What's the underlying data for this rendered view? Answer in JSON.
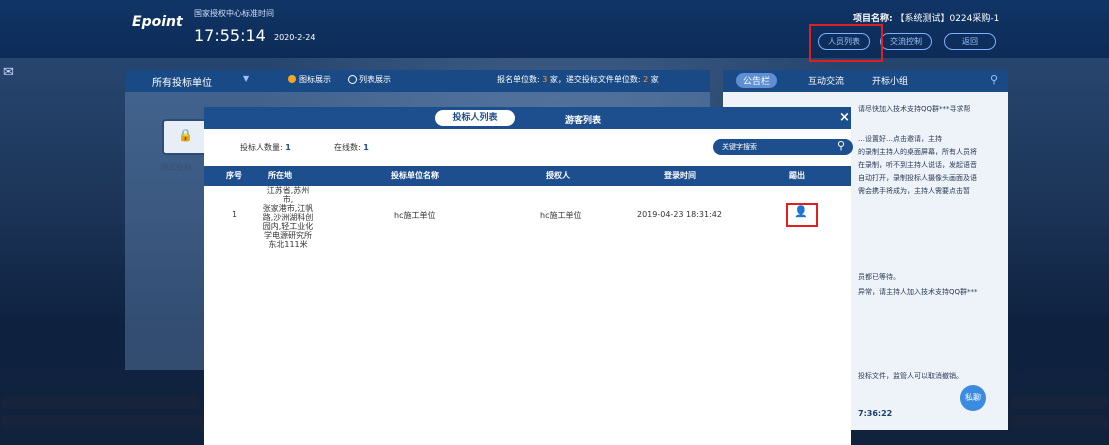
{
  "header": {
    "logo": "Epoint",
    "clock_label": "国家授权中心标准时间",
    "clock_time": "17:55:14",
    "clock_date": "2020-2-24",
    "project_label": "项目名称:",
    "project_value": "【系统测试】0224采购-1",
    "buttons": {
      "people": "人员列表",
      "flow": "交流控制",
      "back": "返回"
    }
  },
  "bidder_panel": {
    "unit_select": "所有投标单位",
    "view_icon_label": "图标展示",
    "view_list_label": "列表展示",
    "stats": {
      "prefix": "报名单位数:",
      "registered": "3",
      "mid": "家，递交投标文件单位数:",
      "submitted": "2",
      "suffix": "家"
    },
    "folder_label": "测试投标"
  },
  "side_panel": {
    "tabs": [
      "公告栏",
      "互动交流",
      "开标小组"
    ],
    "lines": [
      "请尽快加入技术支持QQ群***寻求帮",
      "…设置好…点击邀请，主持",
      "的录制主持人的桌面屏幕，所有人员将",
      "在录制，听不到主持人说话，发起语音",
      "自动打开，录制投标人摄像头画面及语",
      "需会携手将成为，主持人需要点击暂",
      "员都已等待。",
      "异常，请主持人加入技术支持QQ群***",
      "投标文件，监管人可以取消撤销。"
    ],
    "time": "7:36:22",
    "private_btn": "私聊"
  },
  "modal": {
    "tabs": {
      "bidders": "投标人列表",
      "guests": "游客列表"
    },
    "close": "×",
    "count_label": "投标人数量:",
    "count_value": "1",
    "online_label": "在线数:",
    "online_value": "1",
    "search_placeholder": "关键字搜索",
    "columns": [
      "序号",
      "所在地",
      "投标单位名称",
      "授权人",
      "登录时间",
      "踢出"
    ],
    "rows": [
      {
        "no": "1",
        "location_lines": [
          "江苏省,苏州市,",
          "张家港市,江帆",
          "路,沙洲湖科创",
          "园内,轻工业化",
          "学电源研究所",
          "东北111米"
        ],
        "name": "hc施工单位",
        "authorized": "hc施工单位",
        "login_time": "2019-04-23 18:31:42"
      }
    ]
  },
  "colors": {
    "header": "#103566",
    "accent": "#1d4f8f",
    "highlight": "#e02020",
    "stat_number": "#ff9a3c"
  },
  "icons": [
    "corner-app-icon",
    "search-icon",
    "folder-lock-icon",
    "close-icon",
    "kick-user-icon"
  ]
}
